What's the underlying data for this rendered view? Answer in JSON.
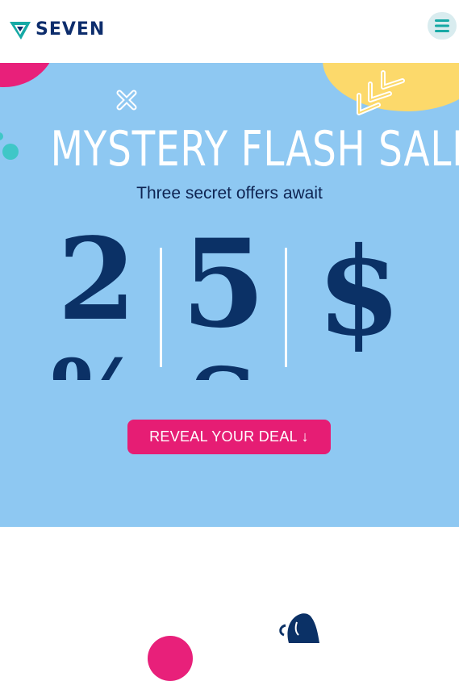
{
  "header": {
    "logo_text": "SEVEN",
    "logo_icon": "seven-chevron-logo",
    "menu_icon": "hamburger-icon"
  },
  "hero": {
    "title": "MYSTERY FLASH SALE!",
    "subtitle": "Three secret offers await",
    "reels": [
      {
        "current": "2",
        "next": "%"
      },
      {
        "current": "5",
        "next": "S"
      },
      {
        "current": "$",
        "next": ""
      }
    ],
    "cta_label": "REVEAL YOUR DEAL ↓"
  },
  "colors": {
    "brand_navy": "#0d2d6c",
    "hero_bg": "#8ec8f2",
    "accent_pink": "#e61d74",
    "accent_yellow": "#fcd96b",
    "accent_teal": "#3fc7c7"
  }
}
